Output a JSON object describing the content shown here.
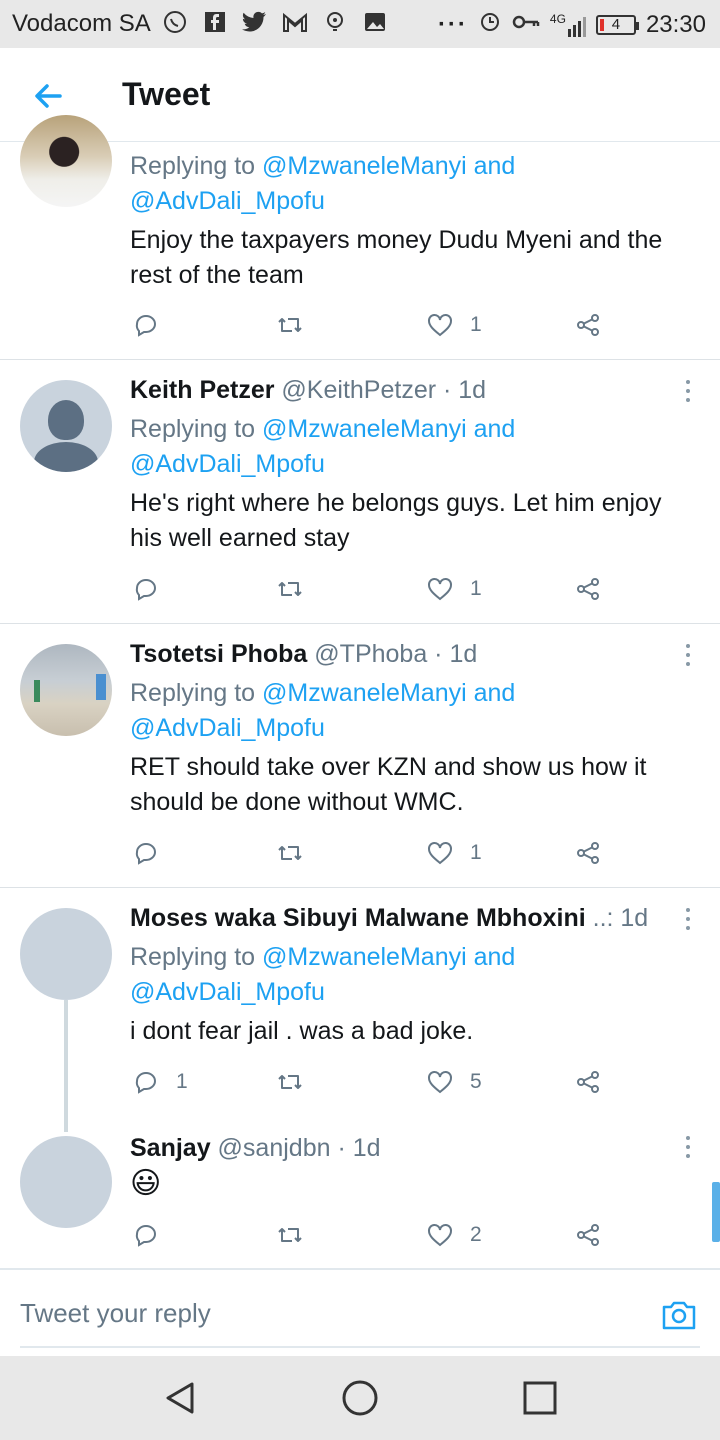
{
  "status_bar": {
    "carrier": "Vodacom SA",
    "network": "4G",
    "battery": "4",
    "time": "23:30",
    "icons": [
      "whatsapp-icon",
      "facebook-icon",
      "twitter-icon",
      "gmail-icon",
      "podcast-icon",
      "gallery-icon",
      "more-dots-icon",
      "alarm-icon",
      "key-icon",
      "signal-icon",
      "battery-icon"
    ],
    "more": "···"
  },
  "header": {
    "title": "Tweet"
  },
  "tweets": [
    {
      "reply_prefix": "Replying to ",
      "reply_handle_1": "@MzwaneleManyi",
      "reply_and": " and",
      "reply_handle_2": "@AdvDali_Mpofu",
      "text_line_1": "Enjoy the taxpayers money Dudu Myeni and the",
      "text_line_2": "rest of the team",
      "replies": "",
      "likes": "1"
    },
    {
      "name": "Keith Petzer",
      "meta": " @KeithPetzer · 1d",
      "reply_prefix": "Replying to ",
      "reply_handle_1": "@MzwaneleManyi",
      "reply_and": " and",
      "reply_handle_2": "@AdvDali_Mpofu",
      "text_line_1": "He's right where he belongs guys. Let him enjoy",
      "text_line_2": "his well earned stay",
      "replies": "",
      "likes": "1"
    },
    {
      "name": "Tsotetsi Phoba",
      "meta": " @TPhoba · 1d",
      "reply_prefix": "Replying to ",
      "reply_handle_1": "@MzwaneleManyi",
      "reply_and": " and",
      "reply_handle_2": "@AdvDali_Mpofu",
      "text_line_1": "RET should take over KZN and show us how it",
      "text_line_2": "should be done without WMC.",
      "replies": "",
      "likes": "1"
    },
    {
      "name": "Moses waka Sibuyi Malwane Mbhoxini",
      "meta": " ..: 1d",
      "reply_prefix": "Replying to ",
      "reply_handle_1": "@MzwaneleManyi",
      "reply_and": " and",
      "reply_handle_2": "@AdvDali_Mpofu",
      "text_line_1": "i dont fear jail .  was a bad joke.",
      "replies": "1",
      "likes": "5"
    },
    {
      "name": "Sanjay",
      "meta": " @sanjdbn · 1d",
      "text_line_1": "😃",
      "replies": "",
      "likes": "2"
    }
  ],
  "reply_bar": {
    "placeholder": "Tweet your reply"
  }
}
